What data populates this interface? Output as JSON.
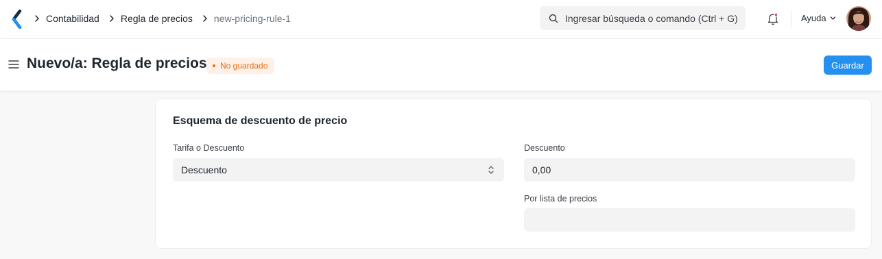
{
  "navbar": {
    "breadcrumbs": [
      "Contabilidad",
      "Regla de precios",
      "new-pricing-rule-1"
    ],
    "search_placeholder": "Ingresar búsqueda o comando (Ctrl + G)",
    "help_label": "Ayuda"
  },
  "page": {
    "title": "Nuevo/a: Regla de precios",
    "status_badge": "No guardado",
    "save_label": "Guardar"
  },
  "section": {
    "title": "Esquema de descuento de precio",
    "fields": {
      "rate_or_discount": {
        "label": "Tarifa o Descuento",
        "value": "Descuento"
      },
      "discount": {
        "label": "Descuento",
        "value": "0,00"
      },
      "for_price_list": {
        "label": "Por lista de precios",
        "value": ""
      }
    }
  },
  "colors": {
    "primary": "#2490ef",
    "badge_text": "#e86c13",
    "badge_bg": "#fff1e7",
    "control_bg": "#f3f3f4"
  },
  "icons": [
    "logo-icon",
    "chevron-right-icon",
    "search-icon",
    "bell-icon",
    "chevron-down-icon",
    "avatar",
    "menu-icon",
    "select-arrows-icon"
  ]
}
